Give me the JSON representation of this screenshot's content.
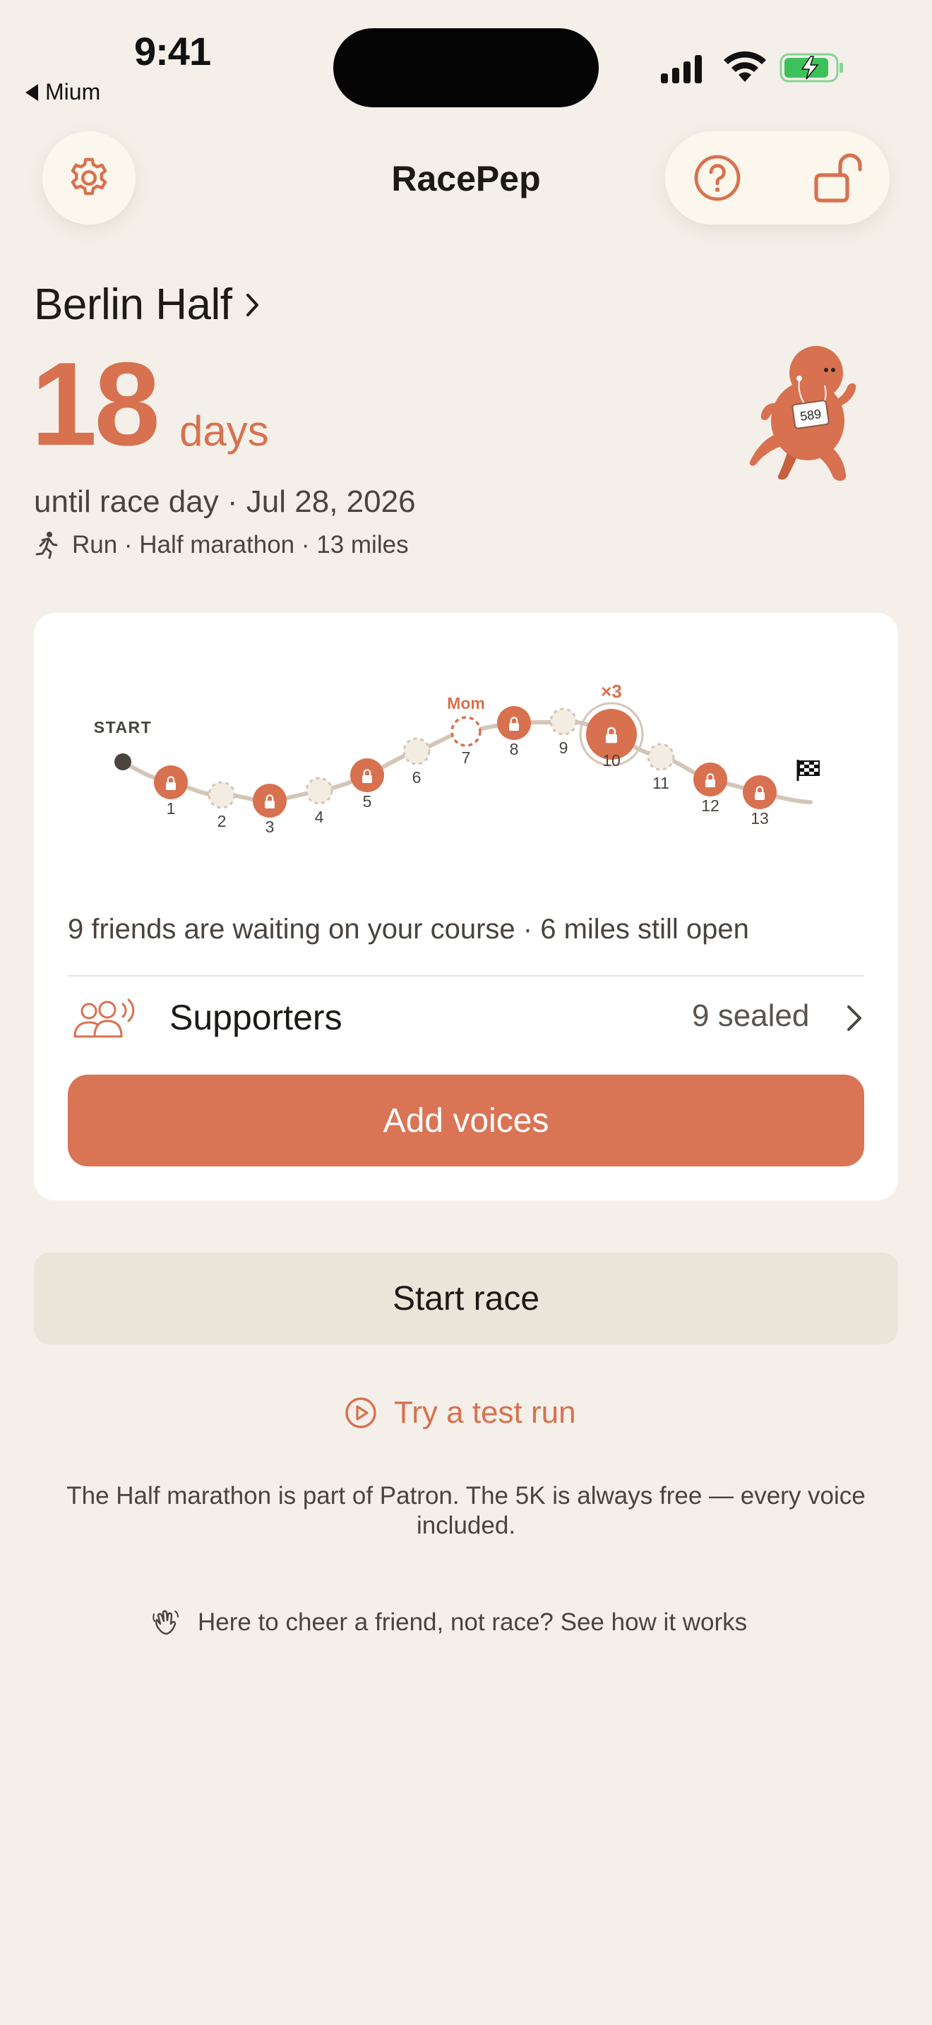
{
  "status_bar": {
    "time": "9:41",
    "back_app": "Mium",
    "battery_color": "#3CC15B"
  },
  "nav": {
    "title": "RacePep",
    "settings_icon": "gear-icon",
    "help_icon": "question-circle-icon",
    "lock_icon": "unlocked-padlock-icon"
  },
  "race": {
    "name": "Berlin Half",
    "days_count": "18",
    "days_label": "days",
    "until_text": "until race day · Jul 28, 2026",
    "meta": "Run · Half marathon · 13 miles",
    "bib_number": "589"
  },
  "course": {
    "start_label": "START",
    "miles": [
      {
        "mile": "1",
        "state": "sealed"
      },
      {
        "mile": "2",
        "state": "open"
      },
      {
        "mile": "3",
        "state": "sealed"
      },
      {
        "mile": "4",
        "state": "open"
      },
      {
        "mile": "5",
        "state": "sealed"
      },
      {
        "mile": "6",
        "state": "open"
      },
      {
        "mile": "7",
        "state": "reserved",
        "tag": "Mom"
      },
      {
        "mile": "8",
        "state": "sealed"
      },
      {
        "mile": "9",
        "state": "open"
      },
      {
        "mile": "10",
        "state": "sealed",
        "tag": "×3"
      },
      {
        "mile": "11",
        "state": "open"
      },
      {
        "mile": "12",
        "state": "sealed"
      },
      {
        "mile": "13",
        "state": "sealed"
      }
    ]
  },
  "card": {
    "summary": "9 friends are waiting on your course · 6 miles still open",
    "supporters_label": "Supporters",
    "supporters_count": "9 sealed",
    "add_voices_label": "Add voices"
  },
  "actions": {
    "start_race_label": "Start race",
    "test_run_label": "Try a test run"
  },
  "footer": {
    "notice": "The Half marathon is part of Patron. The 5K is always free — every voice included.",
    "cheer_link": "Here to cheer a friend, not race? See how it works"
  },
  "colors": {
    "accent": "#D8714F",
    "background": "#F4F0E9",
    "card": "#FFFFFF",
    "secondary_button": "#EBE4D8"
  }
}
